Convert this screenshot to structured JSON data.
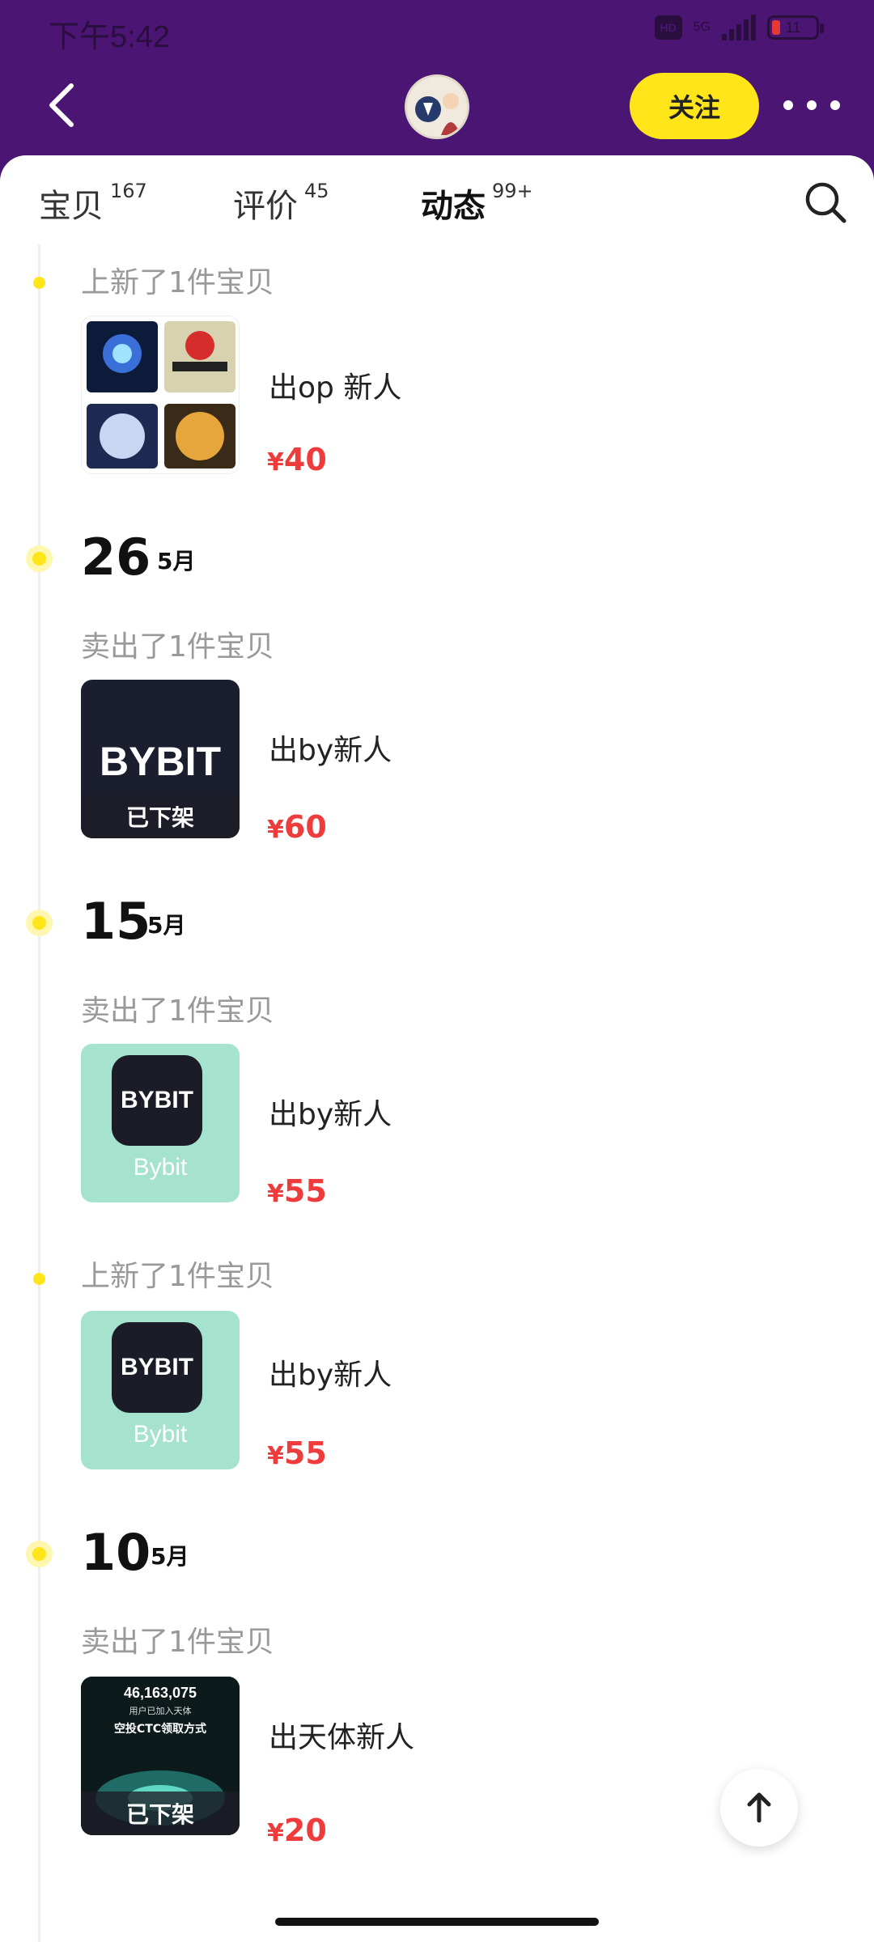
{
  "status_bar": {
    "time": "下午5:42",
    "hd": "HD",
    "network": "5G",
    "battery": "11"
  },
  "header": {
    "follow_label": "关注"
  },
  "tabs": [
    {
      "label": "宝贝",
      "count": "167"
    },
    {
      "label": "评价",
      "count": "45"
    },
    {
      "label": "动态",
      "count": "99+"
    }
  ],
  "feed": {
    "entry1": {
      "event": "上新了1件宝贝",
      "title": "出op 新人",
      "price": "40",
      "currency": "¥"
    },
    "date1": {
      "day": "26",
      "month": "5月"
    },
    "entry2": {
      "event": "卖出了1件宝贝",
      "title": "出by新人",
      "price": "60",
      "currency": "¥",
      "badge": "已下架",
      "thumb_text": "BYBIT"
    },
    "date2": {
      "day": "15",
      "month": "5月"
    },
    "entry3": {
      "event": "卖出了1件宝贝",
      "title": "出by新人",
      "price": "55",
      "currency": "¥",
      "thumb_text": "BYBIT",
      "thumb_caption": "Bybit"
    },
    "entry4": {
      "event": "上新了1件宝贝",
      "title": "出by新人",
      "price": "55",
      "currency": "¥",
      "thumb_text": "BYBIT",
      "thumb_caption": "Bybit"
    },
    "date3": {
      "day": "10",
      "month": "5月"
    },
    "entry5": {
      "event": "卖出了1件宝贝",
      "title": "出天体新人",
      "price": "20",
      "currency": "¥",
      "badge": "已下架",
      "thumb_number": "46,163,075",
      "thumb_line1": "用户已加入天体",
      "thumb_line2": "空投CTC领取方式"
    }
  },
  "colors": {
    "brand_purple": "#4b1573",
    "accent_yellow": "#ffe51a",
    "price_red": "#ee3b3b"
  }
}
